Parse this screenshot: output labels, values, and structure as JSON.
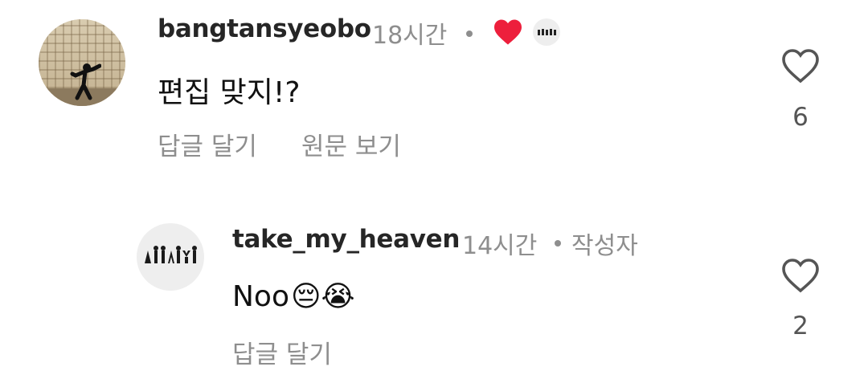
{
  "comments": [
    {
      "username": "bangtansyeobo",
      "time": "18시간",
      "text": "편집 맞지!?",
      "reply_label": "답글 달기",
      "translate_label": "원문 보기",
      "like_count": "6",
      "avatar_icon": "profile-photo",
      "liked_by_author": true,
      "author_badge_icon": "author-avatar-mini"
    },
    {
      "username": "take_my_heaven",
      "time": "14시간",
      "author_label": "작성자",
      "text": "Noo",
      "emojis": [
        "😔",
        "😭"
      ],
      "reply_label": "답글 달기",
      "like_count": "2",
      "avatar_icon": "silhouette-group-logo"
    }
  ],
  "colors": {
    "heart_red": "#ed1f3c",
    "meta_gray": "#8e8e8e"
  }
}
